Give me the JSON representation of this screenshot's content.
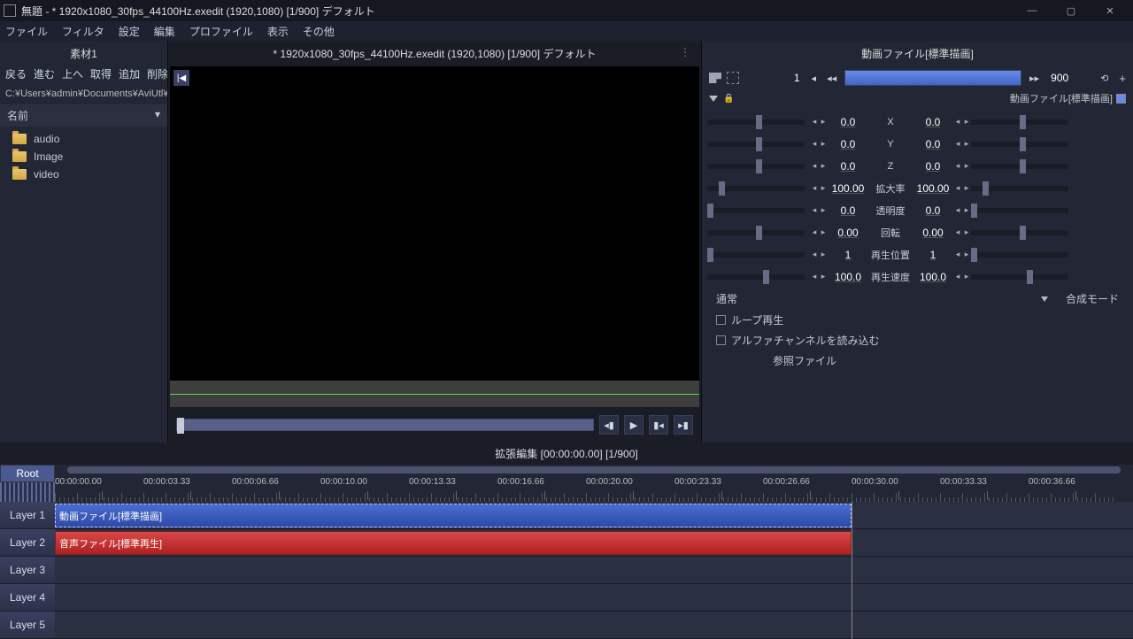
{
  "window": {
    "title": "無題 - * 1920x1080_30fps_44100Hz.exedit (1920,1080)  [1/900]  デフォルト"
  },
  "menu": {
    "file": "ファイル",
    "filter": "フィルタ",
    "setting": "設定",
    "edit": "編集",
    "profile": "プロファイル",
    "view": "表示",
    "other": "その他"
  },
  "filepanel": {
    "title": "素材1",
    "nav": {
      "back": "戻る",
      "fwd": "進む",
      "up": "上へ",
      "get": "取得",
      "add": "追加",
      "del": "削除"
    },
    "path": "C:¥Users¥admin¥Documents¥AviUtl¥pr",
    "header": "名前",
    "dropdown": "▾",
    "items": [
      {
        "name": "audio"
      },
      {
        "name": "Image"
      },
      {
        "name": "video"
      }
    ]
  },
  "preview": {
    "title": "* 1920x1080_30fps_44100Hz.exedit (1920,1080)  [1/900]  デフォルト",
    "dots": "⋮",
    "corner": "|◀"
  },
  "props": {
    "title": "動画ファイル[標準描画]",
    "from": "1",
    "to": "900",
    "subtitle": "動画ファイル[標準描画]",
    "rows": [
      {
        "v1": "0.0",
        "label": "X",
        "v2": "0.0",
        "s1": 50,
        "s2": 50
      },
      {
        "v1": "0.0",
        "label": "Y",
        "v2": "0.0",
        "s1": 50,
        "s2": 50
      },
      {
        "v1": "0.0",
        "label": "Z",
        "v2": "0.0",
        "s1": 50,
        "s2": 50
      },
      {
        "v1": "100.00",
        "label": "拡大率",
        "v2": "100.00",
        "s1": 12,
        "s2": 12
      },
      {
        "v1": "0.0",
        "label": "透明度",
        "v2": "0.0",
        "s1": 0,
        "s2": 0
      },
      {
        "v1": "0.00",
        "label": "回転",
        "v2": "0.00",
        "s1": 50,
        "s2": 50
      },
      {
        "v1": "1",
        "label": "再生位置",
        "v2": "1",
        "s1": 0,
        "s2": 0
      },
      {
        "v1": "100.0",
        "label": "再生速度",
        "v2": "100.0",
        "s1": 57,
        "s2": 57
      }
    ],
    "blend_value": "通常",
    "blend_label": "合成モード",
    "loop": "ループ再生",
    "alpha": "アルファチャンネルを読み込む",
    "ref": "参照ファイル"
  },
  "timeline": {
    "title": "拡張編集 [00:00:00.00] [1/900]",
    "root": "Root",
    "layers": [
      "Layer 1",
      "Layer 2",
      "Layer 3",
      "Layer 4",
      "Layer 5"
    ],
    "clip_video": "動画ファイル[標準描画]",
    "clip_audio": "音声ファイル[標準再生]",
    "ticks": [
      "00:00:00.00",
      "00:00:03.33",
      "00:00:06.66",
      "00:00:10.00",
      "00:00:13.33",
      "00:00:16.66",
      "00:00:20.00",
      "00:00:23.33",
      "00:00:26.66",
      "00:00:30.00",
      "00:00:33.33",
      "00:00:36.66"
    ]
  }
}
